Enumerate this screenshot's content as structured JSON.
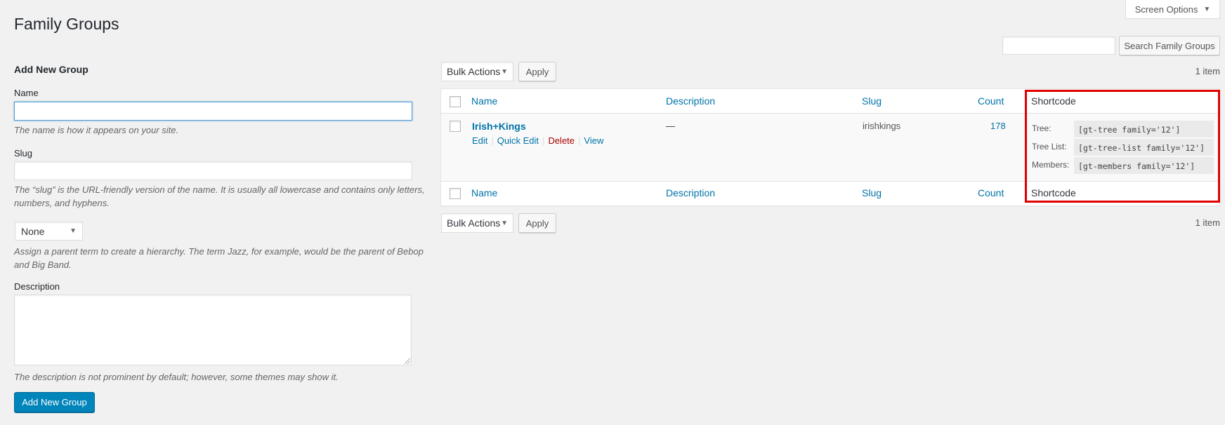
{
  "header": {
    "title": "Family Groups",
    "screen_options_label": "Screen Options",
    "search": {
      "value": "",
      "placeholder": "",
      "button_label": "Search Family Groups"
    }
  },
  "form": {
    "heading": "Add New Group",
    "name": {
      "label": "Name",
      "value": "",
      "help": "The name is how it appears on your site."
    },
    "slug": {
      "label": "Slug",
      "value": "",
      "help": "The “slug” is the URL-friendly version of the name. It is usually all lowercase and contains only letters, numbers, and hyphens."
    },
    "parent": {
      "selected": "None",
      "help": "Assign a parent term to create a hierarchy. The term Jazz, for example, would be the parent of Bebop and Big Band."
    },
    "description": {
      "label": "Description",
      "value": "",
      "help": "The description is not prominent by default; however, some themes may show it."
    },
    "submit_label": "Add New Group"
  },
  "list": {
    "bulk_actions": {
      "selected": "Bulk Actions",
      "apply_label": "Apply"
    },
    "item_count": "1 item",
    "columns": [
      "Name",
      "Description",
      "Slug",
      "Count",
      "Shortcode"
    ],
    "rows": [
      {
        "name": "Irish+Kings",
        "description": "—",
        "slug": "irishkings",
        "count": "178",
        "actions": [
          "Edit",
          "Quick Edit",
          "Delete",
          "View"
        ],
        "shortcodes": [
          {
            "label": "Tree:",
            "code": "[gt-tree family='12']"
          },
          {
            "label": "Tree List:",
            "code": "[gt-tree-list family='12']"
          },
          {
            "label": "Members:",
            "code": "[gt-members family='12']"
          }
        ]
      }
    ]
  },
  "colors": {
    "primary": "#0085ba",
    "link": "#0073aa",
    "delete": "#aa0000",
    "highlight": "#e10000"
  }
}
